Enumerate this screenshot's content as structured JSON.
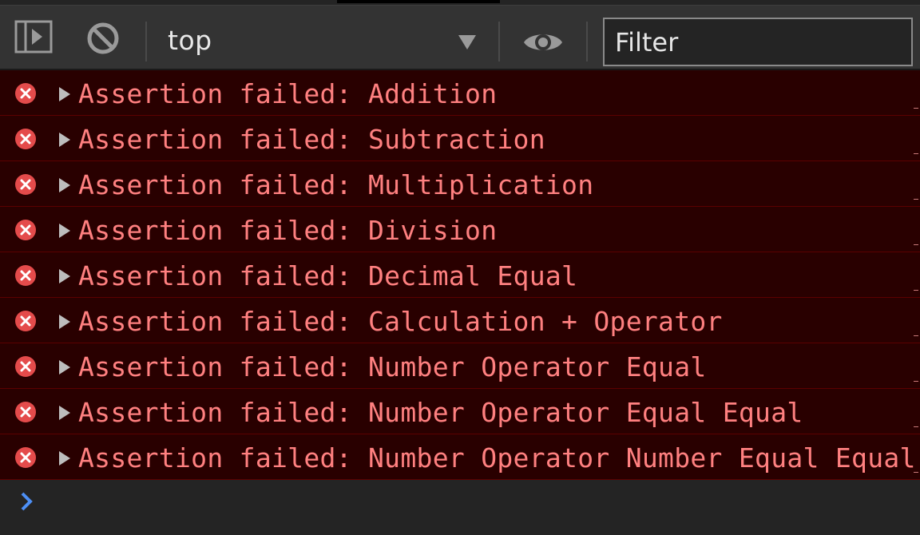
{
  "toolbar": {
    "context": "top",
    "filter_placeholder": "Filter"
  },
  "messages": [
    {
      "text": "Assertion failed: Addition"
    },
    {
      "text": "Assertion failed: Subtraction"
    },
    {
      "text": "Assertion failed: Multiplication"
    },
    {
      "text": "Assertion failed: Division"
    },
    {
      "text": "Assertion failed: Decimal Equal"
    },
    {
      "text": "Assertion failed: Calculation + Operator"
    },
    {
      "text": "Assertion failed: Number Operator Equal"
    },
    {
      "text": "Assertion failed: Number Operator Equal Equal"
    },
    {
      "text": "Assertion failed: Number Operator Number Equal Equal"
    }
  ],
  "colors": {
    "error_bg": "#290000",
    "error_text": "#ff8080",
    "error_icon": "#e44b4b",
    "prompt": "#4d8ff5"
  },
  "icons": {
    "sidebar": "sidebar-toggle-icon",
    "clear": "clear-console-icon",
    "context_dropdown": "triangle-down-icon",
    "live_expression": "eye-icon",
    "error": "error-circle-icon",
    "expand": "triangle-right-icon",
    "prompt": "chevron-right-icon"
  }
}
